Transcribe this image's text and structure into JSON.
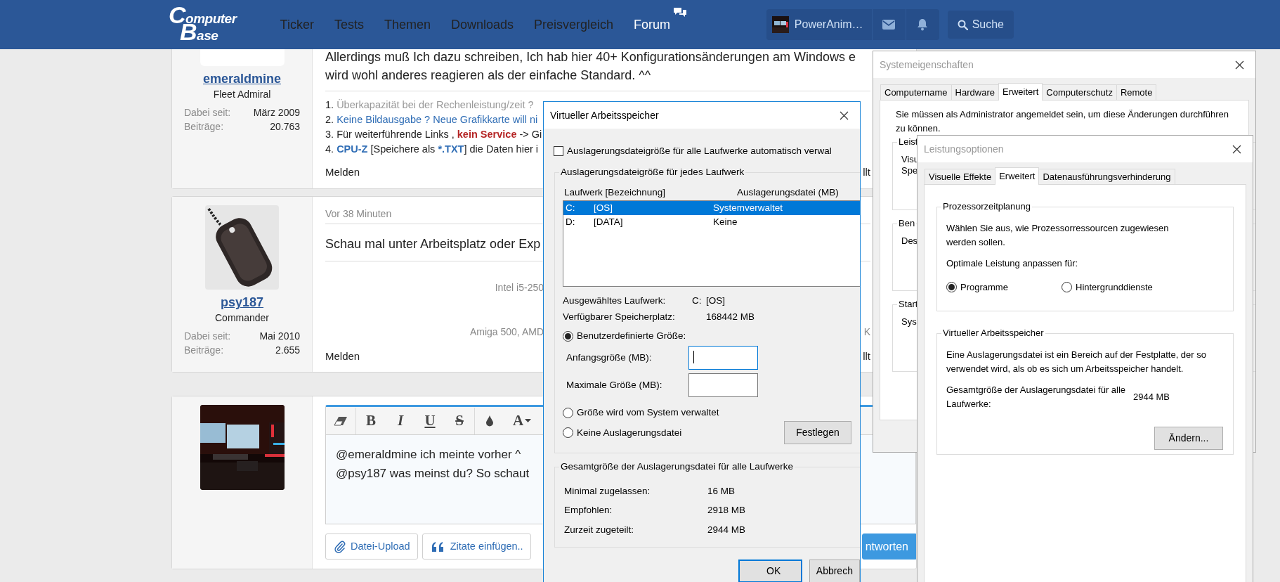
{
  "header": {
    "logo": [
      "Computer",
      "Base"
    ],
    "nav": [
      {
        "label": "Ticker",
        "has_icon": false
      },
      {
        "label": "Tests",
        "has_icon": false
      },
      {
        "label": "Themen",
        "has_icon": false
      },
      {
        "label": "Downloads",
        "has_icon": false
      },
      {
        "label": "Preisvergleich",
        "has_icon": false
      },
      {
        "label": "Forum",
        "has_icon": true
      }
    ],
    "user": {
      "name": "PowerAnim…"
    },
    "search": {
      "label": "Suche"
    }
  },
  "posts": [
    {
      "author": "emeraldmine",
      "rank": "Fleet Admiral",
      "avatar": {
        "kind": "blank"
      },
      "stats": [
        {
          "label": "Dabei seit:",
          "value": "März 2009"
        },
        {
          "label": "Beiträge:",
          "value": "20.763"
        }
      ],
      "body": [
        {
          "kind": "paragraph",
          "lines": [
            "Allerdings muß Ich dazu schreiben, Ich hab hier 40+ Konfigurationsänderungen am Windows e",
            "wird wohl anderes reagieren als der einfache Standard. ^^"
          ]
        },
        {
          "kind": "rule"
        },
        {
          "kind": "list",
          "items": [
            {
              "number": "1.",
              "parts": [
                {
                  "text": "Überkapazität bei der Rechenleistung/zeit ?",
                  "kind": "muted"
                }
              ]
            },
            {
              "number": "2.",
              "parts": [
                {
                  "text": "Keine Bildausgabe ? Neue Grafikkarte will ni",
                  "kind": "link"
                }
              ]
            },
            {
              "number": "3.",
              "parts": [
                {
                  "text": "Für weiterführende Links , ",
                  "kind": "plain"
                },
                {
                  "text": "kein Service",
                  "kind": "alert"
                },
                {
                  "text": " -> Gi",
                  "kind": "plain"
                }
              ]
            },
            {
              "number": "4.",
              "parts": [
                {
                  "text": "CPU-Z",
                  "kind": "strong"
                },
                {
                  "text": " [Speichere als ",
                  "kind": "plain"
                },
                {
                  "text": "*.TXT",
                  "kind": "strong"
                },
                {
                  "text": "] die Daten hier i",
                  "kind": "plain"
                }
              ]
            }
          ]
        }
      ],
      "footer": {
        "report": "Melden",
        "aside": "llt"
      }
    },
    {
      "author": "psy187",
      "rank": "Commander",
      "avatar": {
        "kind": "picture"
      },
      "stats": [
        {
          "label": "Dabei seit:",
          "value": "Mai 2010"
        },
        {
          "label": "Beiträge:",
          "value": "2.655"
        }
      ],
      "body": [
        {
          "kind": "meta",
          "text": "Vor 38 Minuten"
        },
        {
          "kind": "rule"
        },
        {
          "kind": "paragraph",
          "lines": [
            "Schau mal unter Arbeitsplatz oder Exp"
          ]
        },
        {
          "kind": "rule"
        },
        {
          "kind": "signature",
          "lines": [
            {
              "text": "Intel i5-250"
            },
            {
              "text": "Amiga 500, AMD",
              "aside": "K"
            }
          ]
        }
      ],
      "footer": {
        "report": "Melden",
        "aside": "llt"
      }
    },
    {
      "avatar": {
        "kind": "picture"
      },
      "editor": {
        "format": [
          "B",
          "I",
          "U",
          "S"
        ],
        "font": "A",
        "lines": [
          "@emeraldmine ich meinte vorher ^",
          "@psy187 was meinst du? So schaut"
        ],
        "buttons": [
          {
            "label": "Datei-Upload",
            "kind": "upload"
          },
          {
            "label": "Zitate einfügen..",
            "kind": "quote"
          },
          {
            "label": "ntworten",
            "kind": "primary"
          }
        ]
      }
    }
  ],
  "page_file_dialog": {
    "title": "Virtueller Arbeitsspeicher",
    "active": true,
    "auto_manage": {
      "label": "Auslagerungsdateigröße für alle Laufwerke automatisch verwal",
      "checked": false
    },
    "drives_group": {
      "title": "Auslagerungsdateigröße für jedes Laufwerk",
      "columns": [
        "Laufwerk [Bezeichnung]",
        "Auslagerungsdatei (MB)"
      ],
      "rows": [
        {
          "drive": "C:",
          "label": "[OS]",
          "paging": "Systemverwaltet",
          "selected": true
        },
        {
          "drive": "D:",
          "label": "[DATA]",
          "paging": "Keine",
          "selected": false
        }
      ],
      "selected_drive": {
        "label": "Ausgewähltes Laufwerk:",
        "drive": "C:",
        "name": "[OS]"
      },
      "free_space": {
        "label": "Verfügbarer Speicherplatz:",
        "value": "168442 MB"
      },
      "options": [
        {
          "label": "Benutzerdefinierte Größe:",
          "selected": true,
          "kind": "custom"
        },
        {
          "label": "Größe wird vom System verwaltet",
          "selected": false,
          "kind": "plain"
        },
        {
          "label": "Keine Auslagerungsdatei",
          "selected": false,
          "kind": "set"
        }
      ],
      "fields": [
        {
          "label": "Anfangsgröße (MB):",
          "focused": true
        },
        {
          "label": "Maximale Größe (MB):",
          "focused": false
        }
      ],
      "set_button": "Festlegen"
    },
    "totals_group": {
      "title": "Gesamtgröße der Auslagerungsdatei für alle Laufwerke",
      "rows": [
        {
          "label": "Minimal zugelassen:",
          "value": "16 MB"
        },
        {
          "label": "Empfohlen:",
          "value": "2918 MB"
        },
        {
          "label": "Zurzeit zugeteilt:",
          "value": "2944 MB"
        }
      ]
    },
    "buttons": [
      {
        "label": "OK",
        "default": true
      },
      {
        "label": "Abbrech",
        "default": false
      }
    ]
  },
  "system_properties": {
    "title": "Systemeigenschaften",
    "active": false,
    "tabs": [
      {
        "label": "Computername",
        "selected": false
      },
      {
        "label": "Hardware",
        "selected": false
      },
      {
        "label": "Erweitert",
        "selected": true
      },
      {
        "label": "Computerschutz",
        "selected": false
      },
      {
        "label": "Remote",
        "selected": false
      }
    ],
    "notice": "Sie müssen als Administrator angemeldet sein, um diese Änderungen durchführen zu können.",
    "groups": [
      {
        "title": "Leist",
        "lines": [
          "Visu",
          "Spe"
        ]
      },
      {
        "title": "Ben",
        "lines": [
          "Des"
        ]
      },
      {
        "title": "Start",
        "lines": [
          "Sys"
        ]
      }
    ]
  },
  "performance_options": {
    "title": "Leistungsoptionen",
    "active": false,
    "tabs": [
      {
        "label": "Visuelle Effekte",
        "selected": false
      },
      {
        "label": "Erweitert",
        "selected": true
      },
      {
        "label": "Datenausführungsverhinderung",
        "selected": false
      }
    ],
    "scheduling": {
      "title": "Prozessorzeitplanung",
      "text": "Wählen Sie aus, wie Prozessorressourcen zugewiesen werden sollen.",
      "prompt": "Optimale Leistung anpassen für:",
      "options": [
        {
          "label": "Programme",
          "selected": true
        },
        {
          "label": "Hintergrunddienste",
          "selected": false
        }
      ]
    },
    "virtual_memory": {
      "title": "Virtueller Arbeitsspeicher",
      "text": "Eine Auslagerungsdatei ist ein Bereich auf der Festplatte, der so verwendet wird, als ob es sich um Arbeitsspeicher handelt.",
      "total_label": "Gesamtgröße der Auslagerungsdatei für alle Laufwerke:",
      "total_value": "2944 MB",
      "button": "Ändern..."
    }
  }
}
